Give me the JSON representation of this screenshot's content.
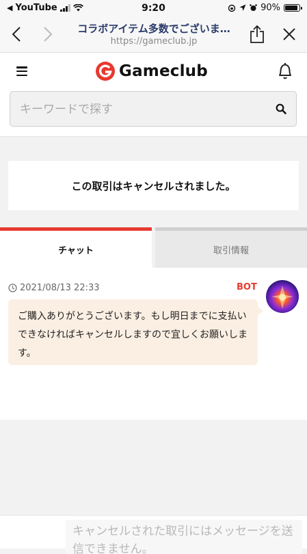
{
  "status_bar": {
    "back_app": "YouTube",
    "time": "9:20",
    "battery_percent": "90%",
    "battery_level": 0.9
  },
  "browser": {
    "page_title": "コラボアイテム多数でございま…",
    "url": "https://gameclub.jp"
  },
  "header": {
    "logo_text": "Gameclub",
    "brand_color": "#e8392f"
  },
  "search": {
    "placeholder": "キーワードで探す"
  },
  "notice": {
    "text": "この取引はキャンセルされました。"
  },
  "tabs": [
    {
      "label": "チャット",
      "active": true
    },
    {
      "label": "取引情報",
      "active": false
    }
  ],
  "chat": {
    "messages": [
      {
        "timestamp": "2021/08/13 22:33",
        "sender": "BOT",
        "text": "ご購入ありがとうございます。もし明日までに支払いできなければキャンセルしますので宜しくお願いします。"
      }
    ]
  },
  "composer": {
    "placeholder": "キャンセルされた取引にはメッセージを送信できません。"
  }
}
